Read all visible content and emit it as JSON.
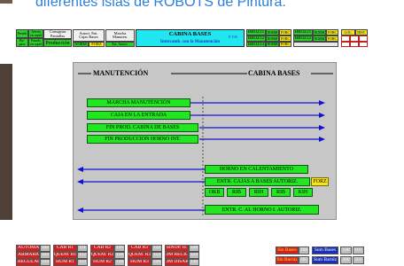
{
  "header_text": "diferentes islas de ROBOTS de Pintura.",
  "top_bar": {
    "parado": "Parado",
    "averia": "Avería",
    "en_rapid": "en rapid",
    "byp": "By-",
    "pass": "pass",
    "parado2": "Parado",
    "en_rapid2": "en rapid",
    "consignas": "Consignas",
    "pantallas": "Pantallas",
    "produccion": "Producción",
    "autori_ent": "Autori. Ent.",
    "cajas_bases": "Cajas Bases",
    "norm": "NORM",
    "forz": "FORZ",
    "marcha": "Marcha",
    "manuten": "Manuten.",
    "est_autori": "Est. Autori.",
    "cabina_title": "CABINA BASES",
    "cabina_sub": "Intercamb. con la Manutención",
    "page_ref": "P.196",
    "robots": [
      {
        "name": "BROZ11",
        "mode1": "NORM",
        "mode2": "FORC"
      },
      {
        "name": "BROZ12",
        "mode1": "NORM",
        "mode2": "FORC"
      },
      {
        "name": "BROZ13",
        "mode1": "NORM",
        "mode2": "FORC"
      },
      {
        "name": "BROZ21",
        "mode1": "NORM",
        "mode2": "FORC"
      },
      {
        "name": "BROZ22",
        "mode1": "NORM",
        "mode2": "FORC"
      }
    ],
    "loc": "LOC.",
    "dist": "DIST."
  },
  "panel": {
    "left_title": "MANUTENCIÓN",
    "right_title": "CABINA BASES",
    "to_cabina": [
      "MARCHA MANUTENCIÓN",
      "CAJA EN LA ENTRADA",
      "FIN PROD. CABINA DE BASES",
      "FIN PRODUCCION HORNO INT."
    ],
    "to_manut": [
      "HORNO EN CALENTAMIENTO",
      "ENTR. CAJAS A BASES AUTORIZ.",
      "ENTR. C. AL HORNO I. AUTORIZ."
    ],
    "forz": "FORZ",
    "colors": [
      "OKB",
      "RIB",
      "RIH",
      "RIB",
      "KIH"
    ]
  },
  "bottom_bar": {
    "row1": [
      {
        "label": "AUTOMATA",
        "value": "102"
      },
      {
        "label": "CAB R1",
        "value": "111"
      },
      {
        "label": "CAB R2",
        "value": "116"
      },
      {
        "label": "CAB R3",
        "value": "122"
      },
      {
        "label": "SINOP. H.",
        "value": "128"
      }
    ],
    "row2": [
      {
        "label": "ARMARIOS",
        "value": "103"
      },
      {
        "label": "QUEM. R1",
        "value": "112"
      },
      {
        "label": "QUEM. R2",
        "value": "118"
      },
      {
        "label": "QUEM. R3",
        "value": "124"
      },
      {
        "label": "OM RECIC",
        "value": "129"
      }
    ],
    "row3": [
      {
        "label": "REGULAC",
        "value": "104"
      },
      {
        "label": "HUM R1",
        "value": "114"
      },
      {
        "label": "HUM R2",
        "value": "120"
      },
      {
        "label": "HUM R3",
        "value": "126"
      },
      {
        "label": "OM DISAR",
        "value": "130"
      }
    ],
    "sin_bases": "Sin Bases",
    "sin_bases_val": "206",
    "sin_barniz": "Sin Barniz",
    "sin_barniz_val": "205",
    "sum_bases": "Sum Bases",
    "sum_bases_vals": [
      "100",
      "101"
    ],
    "sum_barniz": "Sum Barniz",
    "sum_barniz_vals": [
      "200",
      "201"
    ]
  }
}
